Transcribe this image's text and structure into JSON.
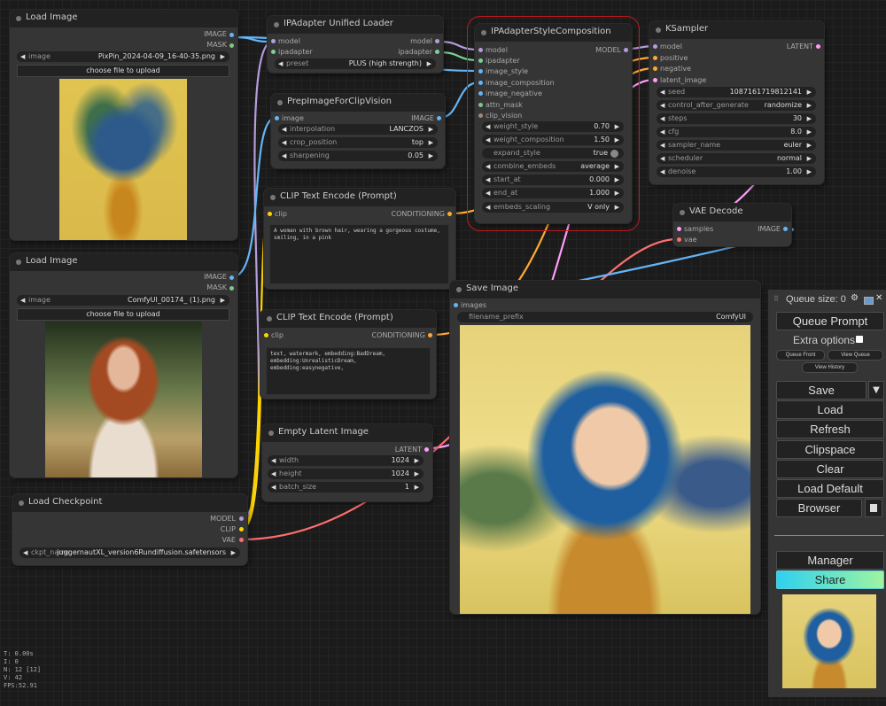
{
  "colors": {
    "model": "#b39ddb",
    "clip": "#ffd500",
    "vae": "#ff6e6e",
    "image": "#64b5f6",
    "conditioning": "#ffa931",
    "latent": "#ff9cf9",
    "ipadapter": "#7cd197",
    "mask": "#81c784",
    "selection": "#c4171c"
  },
  "load_image_1": {
    "title": "Load Image",
    "out_image": "IMAGE",
    "out_mask": "MASK",
    "image_label": "image",
    "image_value": "PixPin_2024-04-09_16-40-35.png",
    "upload": "choose file to upload"
  },
  "load_image_2": {
    "title": "Load Image",
    "out_image": "IMAGE",
    "out_mask": "MASK",
    "image_label": "image",
    "image_value": "ComfyUI_00174_ (1).png",
    "upload": "choose file to upload"
  },
  "load_checkpoint": {
    "title": "Load Checkpoint",
    "out_model": "MODEL",
    "out_clip": "CLIP",
    "out_vae": "VAE",
    "ckpt_label": "ckpt_name",
    "ckpt_value": "juggernautXL_version6Rundiffusion.safetensors"
  },
  "ipa_loader": {
    "title": "IPAdapter Unified Loader",
    "in_model": "model",
    "in_ipadapter": "ipadapter",
    "out_model": "model",
    "out_ipadapter": "ipadapter",
    "preset_label": "preset",
    "preset_value": "PLUS (high strength)"
  },
  "prep_clip": {
    "title": "PrepImageForClipVision",
    "in_image": "image",
    "out_image": "IMAGE",
    "w1_label": "interpolation",
    "w1_value": "LANCZOS",
    "w2_label": "crop_position",
    "w2_value": "top",
    "w3_label": "sharpening",
    "w3_value": "0.05"
  },
  "clip_pos": {
    "title": "CLIP Text Encode (Prompt)",
    "in_clip": "clip",
    "out": "CONDITIONING",
    "text": "A woman with brown hair, wearing a gorgeous costume, smiling, in a pink"
  },
  "clip_neg": {
    "title": "CLIP Text Encode (Prompt)",
    "in_clip": "clip",
    "out": "CONDITIONING",
    "text": "text, watermark, embedding:BadDream, embedding:UnrealisticDream, embedding:easynegative,"
  },
  "empty_latent": {
    "title": "Empty Latent Image",
    "out": "LATENT",
    "w1_label": "width",
    "w1_value": "1024",
    "w2_label": "height",
    "w2_value": "1024",
    "w3_label": "batch_size",
    "w3_value": "1"
  },
  "ipa_style": {
    "title": "IPAdapterStyleComposition",
    "inputs": [
      "model",
      "ipadapter",
      "image_style",
      "image_composition",
      "image_negative",
      "attn_mask",
      "clip_vision"
    ],
    "out": "MODEL",
    "widgets": [
      {
        "label": "weight_style",
        "value": "0.70"
      },
      {
        "label": "weight_composition",
        "value": "1.50"
      },
      {
        "label": "expand_style",
        "value": "true"
      },
      {
        "label": "combine_embeds",
        "value": "average"
      },
      {
        "label": "start_at",
        "value": "0.000"
      },
      {
        "label": "end_at",
        "value": "1.000"
      },
      {
        "label": "embeds_scaling",
        "value": "V only"
      }
    ]
  },
  "ksampler": {
    "title": "KSampler",
    "inputs": [
      "model",
      "positive",
      "negative",
      "latent_image"
    ],
    "out": "LATENT",
    "widgets": [
      {
        "label": "seed",
        "value": "1087161719812141"
      },
      {
        "label": "control_after_generate",
        "value": "randomize"
      },
      {
        "label": "steps",
        "value": "30"
      },
      {
        "label": "cfg",
        "value": "8.0"
      },
      {
        "label": "sampler_name",
        "value": "euler"
      },
      {
        "label": "scheduler",
        "value": "normal"
      },
      {
        "label": "denoise",
        "value": "1.00"
      }
    ]
  },
  "vae_decode": {
    "title": "VAE Decode",
    "in_samples": "samples",
    "in_vae": "vae",
    "out": "IMAGE"
  },
  "save_image": {
    "title": "Save Image",
    "in_images": "images",
    "prefix_label": "filename_prefix",
    "prefix_value": "ComfyUI"
  },
  "sidebar": {
    "queue_size": "Queue size: 0",
    "queue_prompt": "Queue Prompt",
    "extra_options": "Extra options",
    "queue_front": "Queue Front",
    "view_queue": "View Queue",
    "view_history": "View History",
    "save": "Save",
    "load": "Load",
    "refresh": "Refresh",
    "clipspace": "Clipspace",
    "clear": "Clear",
    "load_default": "Load Default",
    "browser": "Browser",
    "manager": "Manager",
    "share": "Share"
  },
  "stats": {
    "t": "T: 0.00s",
    "i": "I: 0",
    "n": "N: 12 [12]",
    "v": "V: 42",
    "fps": "FPS:52.91"
  }
}
